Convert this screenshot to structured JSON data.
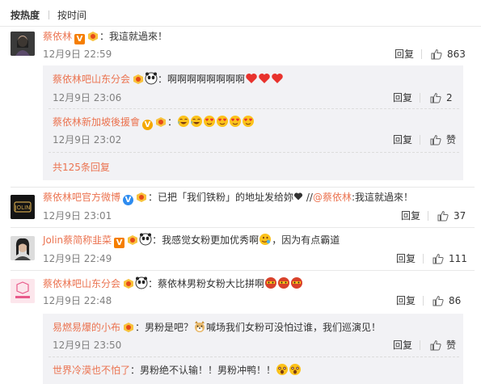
{
  "tabs": {
    "hot": "按热度",
    "time": "按时间"
  },
  "colors": {
    "accent": "#eb7350",
    "subbg": "#f2f2f5",
    "vip": "#f57e00"
  },
  "comments": [
    {
      "user": "蔡依林",
      "sep": "：",
      "text": "我這就過來！",
      "time": "12月9日 22:59",
      "reply": "回复",
      "likes": "863",
      "subs": [
        {
          "user": "蔡依林吧山东分会",
          "sep": "：",
          "text": "啊啊啊啊啊啊啊啊",
          "time": "12月9日 23:06",
          "reply": "回复",
          "likes": "2"
        },
        {
          "user": "蔡依林新加坡後援會",
          "sep": "：",
          "text": "",
          "time": "12月9日 23:02",
          "reply": "回复",
          "likes": "赞"
        }
      ],
      "more": "共125条回复"
    },
    {
      "user": "蔡依林吧官方微博",
      "sep": "：",
      "text": "已把「我们铁粉」的地址发给妳",
      "repost_sep": " //",
      "repost_user": "@蔡依林",
      "repost_text": ":我這就過來！",
      "time": "12月9日 23:01",
      "reply": "回复",
      "likes": "37"
    },
    {
      "user": "Jolin蔡简称韭菜",
      "sep": "：",
      "text": "我感觉女粉更加优秀啊",
      "text2": "，因为有点霸道",
      "time": "12月9日 22:49",
      "reply": "回复",
      "likes": "111"
    },
    {
      "user": "蔡依林吧山东分会",
      "sep": "：",
      "text": "蔡依林男粉女粉大比拼啊",
      "time": "12月9日 22:48",
      "reply": "回复",
      "likes": "86",
      "subs": [
        {
          "user": "易燃易爆的小布",
          "sep": "：",
          "text": "男粉是吧？",
          "text2": "喊场我们女粉可没怕过谁，我们巡演见！",
          "time": "12月9日 23:50",
          "reply": "回复",
          "likes": "赞"
        },
        {
          "user": "世界冷漠也不怕了",
          "sep": "：",
          "text": "男粉绝不认输！！男粉冲鸭！！"
        }
      ]
    }
  ],
  "icons": [
    "like-icon",
    "vip-badge-icon",
    "fan-badge-icon",
    "panda-emoji-icon",
    "heart-emoji-icon",
    "laugh-emoji-icon",
    "heart-eyes-emoji-icon",
    "heart-icon",
    "mask-emoji-icon",
    "shock-emoji-icon",
    "doge-emoji-icon"
  ]
}
